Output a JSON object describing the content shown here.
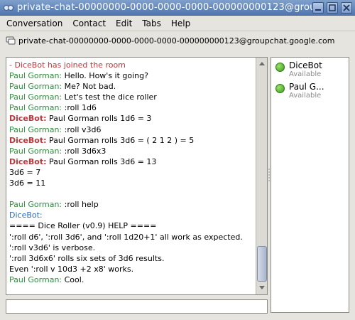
{
  "window": {
    "title": "private-chat-00000000-0000-0000-0000-000000000123@groupchat.google.com"
  },
  "menu": [
    {
      "label": "Conversation"
    },
    {
      "label": "Contact"
    },
    {
      "label": "Edit"
    },
    {
      "label": "Tabs"
    },
    {
      "label": "Help"
    }
  ],
  "room": {
    "title": "private-chat-00000000-0000-0000-0000-000000000123@groupchat.google.com"
  },
  "chat": {
    "lines": [
      {
        "kind": "system",
        "text": " - DiceBot has joined the room"
      },
      {
        "kind": "msg",
        "who": "Paul Gorman:",
        "role": "user",
        "text": " Hello. How's it going?"
      },
      {
        "kind": "msg",
        "who": "Paul Gorman:",
        "role": "user",
        "text": " Me? Not bad."
      },
      {
        "kind": "msg",
        "who": "Paul Gorman:",
        "role": "user",
        "text": " Let's test the dice roller"
      },
      {
        "kind": "msg",
        "who": "Paul Gorman:",
        "role": "user",
        "text": " :roll 1d6"
      },
      {
        "kind": "msg",
        "who": "DiceBot:",
        "role": "bot",
        "text": " Paul Gorman rolls 1d6 = 3"
      },
      {
        "kind": "msg",
        "who": "Paul Gorman:",
        "role": "user",
        "text": " :roll v3d6"
      },
      {
        "kind": "msg",
        "who": "DiceBot:",
        "role": "bot",
        "text": " Paul Gorman rolls 3d6 = ( 2  1  2 ) = 5"
      },
      {
        "kind": "msg",
        "who": "Paul Gorman:",
        "role": "user",
        "text": " :roll 3d6x3"
      },
      {
        "kind": "msg",
        "who": "DiceBot:",
        "role": "bot",
        "text": " Paul Gorman rolls 3d6 = 13"
      },
      {
        "kind": "plain",
        "text": "3d6 = 7"
      },
      {
        "kind": "plain",
        "text": "3d6 = 11"
      },
      {
        "kind": "plain",
        "text": ""
      },
      {
        "kind": "msg",
        "who": "Paul Gorman:",
        "role": "user",
        "text": " :roll help"
      },
      {
        "kind": "msg",
        "who": "DiceBot:",
        "role": "botplain",
        "text": ""
      },
      {
        "kind": "plain",
        "text": "==== Dice Roller (v0.9) HELP ===="
      },
      {
        "kind": "plain",
        "text": "':roll d6', ':roll 3d6', and ':roll 1d20+1' all work as expected."
      },
      {
        "kind": "plain",
        "text": "':roll v3d6' is verbose."
      },
      {
        "kind": "plain",
        "text": "':roll 3d6x6' rolls six sets of 3d6 results."
      },
      {
        "kind": "plain",
        "text": "Even ':roll v 10d3 +2 x8' works."
      },
      {
        "kind": "msg",
        "who": "Paul Gorman:",
        "role": "user",
        "text": " Cool."
      }
    ]
  },
  "members": [
    {
      "name": "DiceBot",
      "status": "Available"
    },
    {
      "name": "Paul G...",
      "status": "Available"
    }
  ],
  "input": {
    "value": ""
  }
}
